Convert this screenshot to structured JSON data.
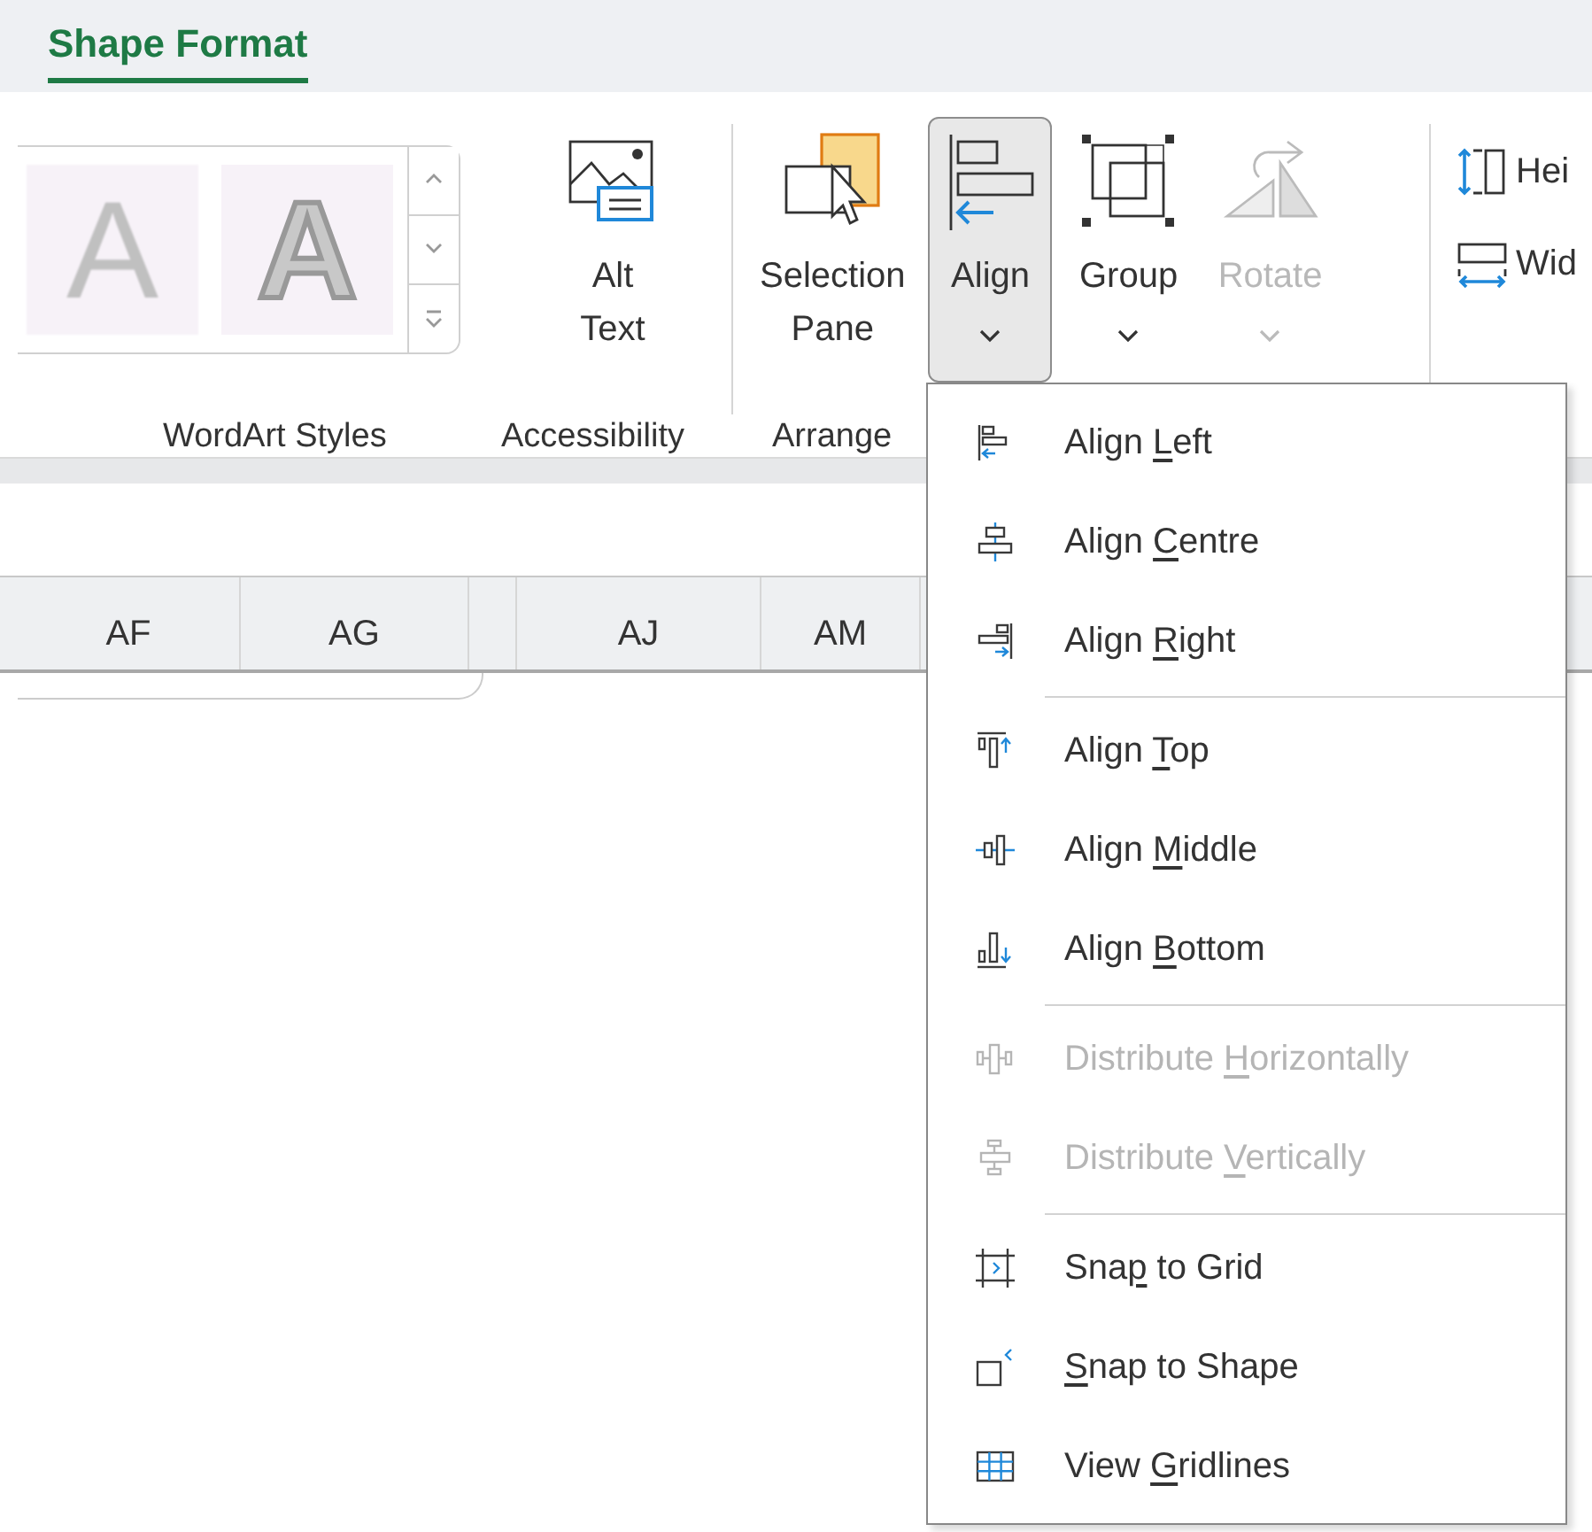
{
  "tab": {
    "label": "Shape Format",
    "selected": true
  },
  "ribbon": {
    "wordart": {
      "samples": [
        {
          "text": "A",
          "kind": "fill"
        },
        {
          "text": "A",
          "kind": "outline"
        }
      ],
      "group_label": "WordArt Styles"
    },
    "accessibility": {
      "buttons": [
        {
          "label": "Alt\nText",
          "dropdown": false,
          "pressed": false,
          "disabled": false
        }
      ],
      "group_label": "Accessibility"
    },
    "arrange": {
      "buttons": [
        {
          "label": "Selection\nPane",
          "dropdown": false,
          "pressed": false,
          "disabled": false
        },
        {
          "label": "Align",
          "dropdown": true,
          "pressed": true,
          "disabled": false
        },
        {
          "label": "Group",
          "dropdown": true,
          "pressed": false,
          "disabled": false
        },
        {
          "label": "Rotate",
          "dropdown": true,
          "pressed": false,
          "disabled": true
        }
      ],
      "group_label": "Arrange"
    },
    "size": {
      "items": [
        "Hei",
        "Wid"
      ]
    }
  },
  "columns": [
    "AF",
    "AG",
    "AJ",
    "AM"
  ],
  "menu": {
    "items": [
      {
        "kind": "item",
        "before": "Align ",
        "key": "L",
        "after": "eft",
        "disabled": false
      },
      {
        "kind": "item",
        "before": "Align ",
        "key": "C",
        "after": "entre",
        "disabled": false
      },
      {
        "kind": "item",
        "before": "Align ",
        "key": "R",
        "after": "ight",
        "disabled": false
      },
      {
        "kind": "separator"
      },
      {
        "kind": "item",
        "before": "Align ",
        "key": "T",
        "after": "op",
        "disabled": false
      },
      {
        "kind": "item",
        "before": "Align ",
        "key": "M",
        "after": "iddle",
        "disabled": false
      },
      {
        "kind": "item",
        "before": "Align ",
        "key": "B",
        "after": "ottom",
        "disabled": false
      },
      {
        "kind": "separator"
      },
      {
        "kind": "item",
        "before": "Distribute ",
        "key": "H",
        "after": "orizontally",
        "disabled": true
      },
      {
        "kind": "item",
        "before": "Distribute ",
        "key": "V",
        "after": "ertically",
        "disabled": true
      },
      {
        "kind": "separator"
      },
      {
        "kind": "item",
        "before": "Sna",
        "key": "p",
        "after": " to Grid",
        "disabled": false
      },
      {
        "kind": "item",
        "key": "S",
        "after": "nap to Shape",
        "disabled": false
      },
      {
        "kind": "item",
        "before": "View ",
        "key": "G",
        "after": "ridlines",
        "disabled": false
      }
    ]
  }
}
